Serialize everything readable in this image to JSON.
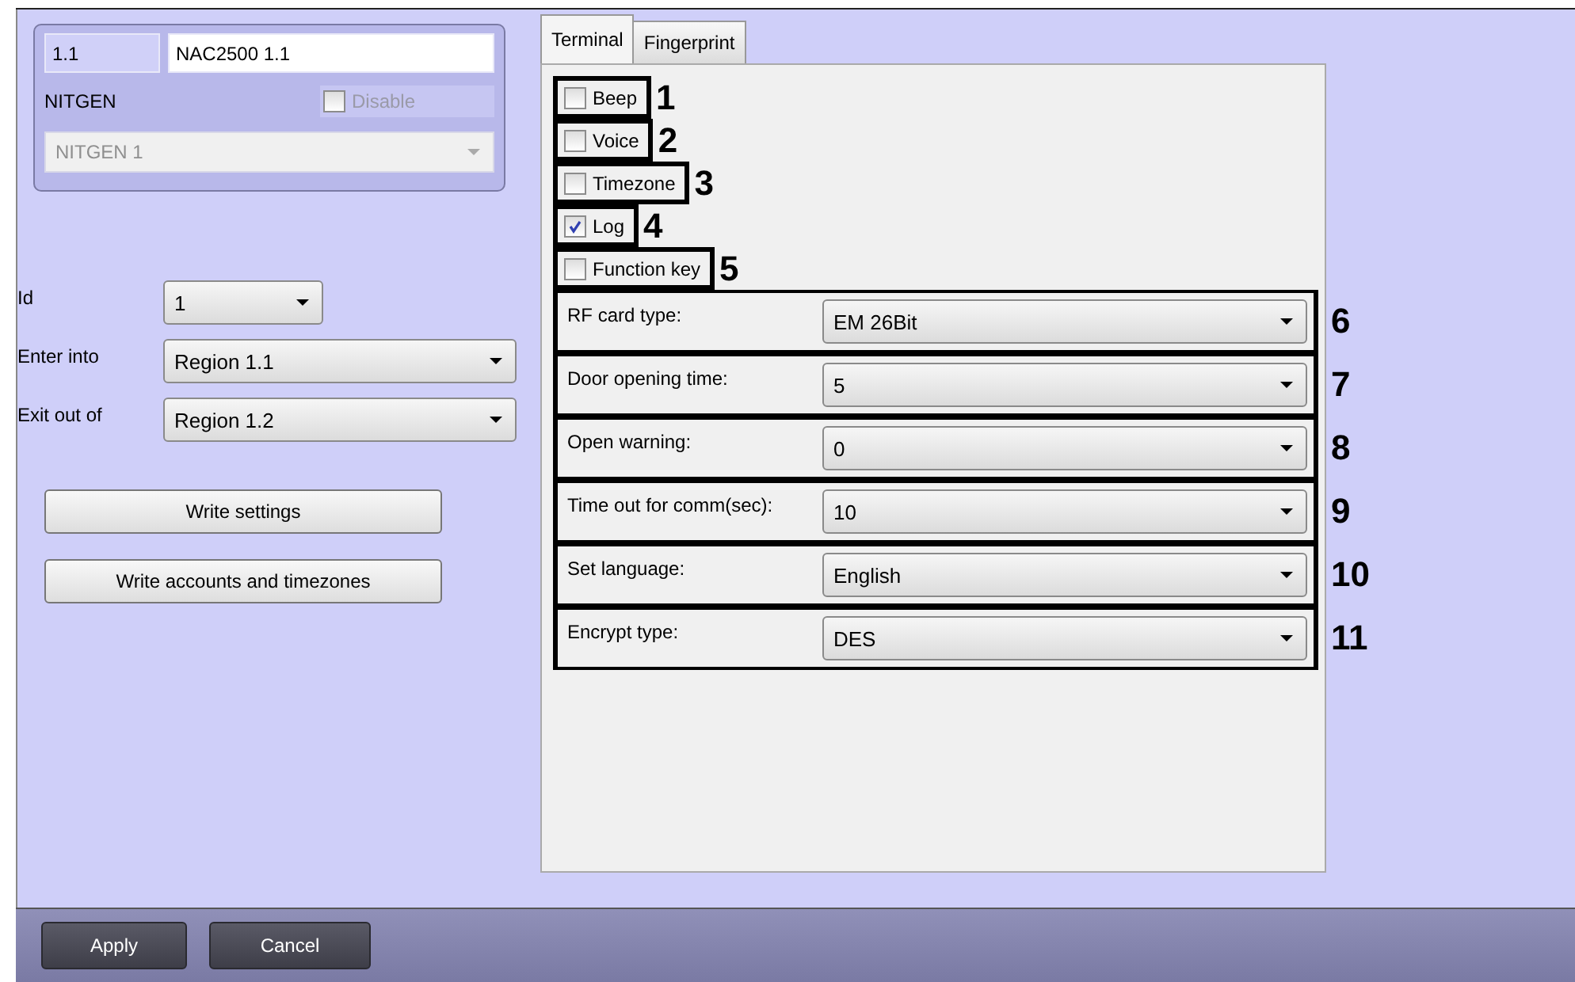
{
  "header": {
    "id": "1.1",
    "name": "NAC2500 1.1",
    "device_label": "NITGEN",
    "disable": {
      "label": "Disable",
      "checked": false,
      "disabled": true
    },
    "device": {
      "value": "NITGEN 1",
      "disabled": true
    }
  },
  "fields": [
    {
      "label": "Id",
      "value": "1",
      "kind": "short"
    },
    {
      "label": "Enter into",
      "value": "Region 1.1",
      "kind": "wide"
    },
    {
      "label": "Exit out of",
      "value": "Region 1.2",
      "kind": "wide"
    }
  ],
  "actions": [
    "Write settings",
    "Write accounts and timezones"
  ],
  "tabs": [
    {
      "label": "Terminal",
      "selected": true
    },
    {
      "label": "Fingerprint",
      "selected": false
    }
  ],
  "options": [
    {
      "label": "Beep",
      "checked": false,
      "annotation": "1"
    },
    {
      "label": "Voice",
      "checked": false,
      "annotation": "2"
    },
    {
      "label": "Timezone",
      "checked": false,
      "annotation": "3"
    },
    {
      "label": "Log",
      "checked": true,
      "annotation": "4"
    },
    {
      "label": "Function key",
      "checked": false,
      "annotation": "5"
    }
  ],
  "settings": [
    {
      "label": "RF card type:",
      "value": "EM 26Bit",
      "annotation": "6"
    },
    {
      "label": "Door opening time:",
      "value": "5",
      "annotation": "7"
    },
    {
      "label": "Open warning:",
      "value": "0",
      "annotation": "8"
    },
    {
      "label": "Time out for comm(sec):",
      "value": "10",
      "annotation": "9"
    },
    {
      "label": "Set language:",
      "value": "English",
      "annotation": "10"
    },
    {
      "label": "Encrypt type:",
      "value": "DES",
      "annotation": "11"
    }
  ],
  "footer": {
    "buttons": [
      "Apply",
      "Cancel"
    ]
  }
}
